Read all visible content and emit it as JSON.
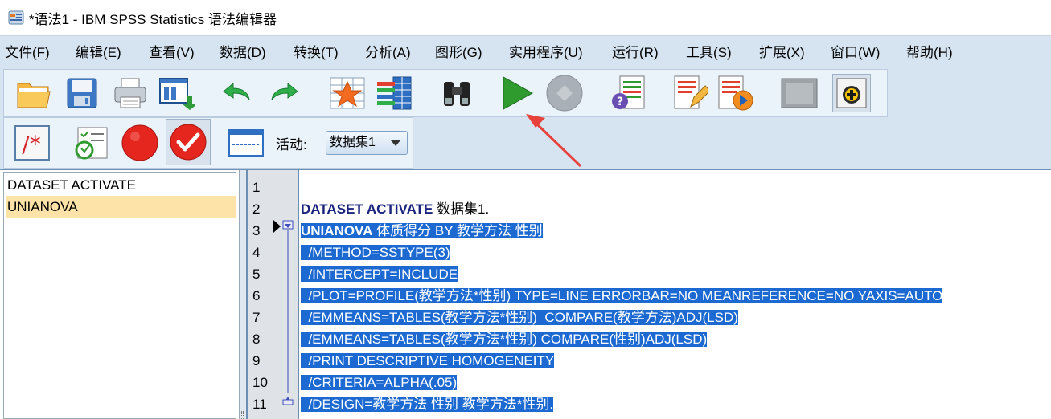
{
  "window": {
    "title": "*语法1 - IBM SPSS Statistics 语法编辑器"
  },
  "menu": {
    "items": [
      "文件(F)",
      "编辑(E)",
      "查看(V)",
      "数据(D)",
      "转换(T)",
      "分析(A)",
      "图形(G)",
      "实用程序(U)",
      "运行(R)",
      "工具(S)",
      "扩展(X)",
      "窗口(W)",
      "帮助(H)"
    ]
  },
  "toolbar": {
    "icons": [
      "open-folder-icon",
      "save-icon",
      "print-icon",
      "recall-dialog-icon",
      "undo-icon",
      "redo-icon",
      "variables-icon",
      "data-list-icon",
      "find-binoculars-icon",
      "run-icon",
      "stop-icon",
      "syntax-help-icon",
      "edit-script-icon",
      "play-script-icon",
      "gray-box-icon",
      "add-extension-icon"
    ],
    "row2_icons": [
      "comment-icon",
      "validate-icon",
      "record-icon",
      "check-icon",
      "format-icon"
    ],
    "active_label": "活动:",
    "dataset_value": "数据集1"
  },
  "navigator": {
    "items": [
      "DATASET ACTIVATE",
      "UNIANOVA"
    ],
    "selected_index": 1
  },
  "editor": {
    "lines": [
      {
        "num": "1",
        "kw": "",
        "text": "",
        "selected": false
      },
      {
        "num": "2",
        "kw": "DATASET ACTIVATE",
        "text": " 数据集1.",
        "selected": false
      },
      {
        "num": "3",
        "kw": "UNIANOVA",
        "text": " 体质得分 BY 教学方法 性别",
        "selected": true
      },
      {
        "num": "4",
        "kw": "",
        "text": "  /METHOD=SSTYPE(3)",
        "selected": true
      },
      {
        "num": "5",
        "kw": "",
        "text": "  /INTERCEPT=INCLUDE",
        "selected": true
      },
      {
        "num": "6",
        "kw": "",
        "text": "  /PLOT=PROFILE(教学方法*性别) TYPE=LINE ERRORBAR=NO MEANREFERENCE=NO YAXIS=AUTO",
        "selected": true
      },
      {
        "num": "7",
        "kw": "",
        "text": "  /EMMEANS=TABLES(教学方法*性别)  COMPARE(教学方法)ADJ(LSD)",
        "selected": true
      },
      {
        "num": "8",
        "kw": "",
        "text": "  /EMMEANS=TABLES(教学方法*性别) COMPARE(性别)ADJ(LSD)",
        "selected": true
      },
      {
        "num": "9",
        "kw": "",
        "text": "  /PRINT DESCRIPTIVE HOMOGENEITY",
        "selected": true
      },
      {
        "num": "10",
        "kw": "",
        "text": "  /CRITERIA=ALPHA(.05)",
        "selected": true
      },
      {
        "num": "11",
        "kw": "",
        "text": "  /DESIGN=教学方法 性别 教学方法*性别.",
        "selected": true
      }
    ]
  },
  "colors": {
    "selection": "#1c6ad1",
    "annotation_arrow": "#e8413b",
    "menubar_bg": "#d6e4f1"
  }
}
